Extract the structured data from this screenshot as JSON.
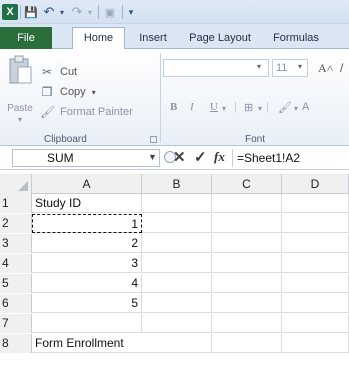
{
  "qat": {
    "logo": "X",
    "save": "💾",
    "undo": "↶",
    "redo": "↷",
    "extra": "▣"
  },
  "tabs": [
    {
      "label": "File"
    },
    {
      "label": "Home"
    },
    {
      "label": "Insert"
    },
    {
      "label": "Page Layout"
    },
    {
      "label": "Formulas"
    }
  ],
  "ribbon": {
    "paste": "Paste",
    "cut": "Cut",
    "copy": "Copy",
    "format_painter": "Format Painter",
    "clipboard_label": "Clipboard",
    "font_size": "11",
    "font_label": "Font",
    "bold": "B",
    "italic": "I",
    "underline": "U"
  },
  "formula_bar": {
    "name_box": "SUM",
    "cancel": "✕",
    "enter": "✓",
    "fx": "fx",
    "formula": "=Sheet1!A2"
  },
  "grid": {
    "columns": [
      "A",
      "B",
      "C",
      "D"
    ],
    "rows": [
      {
        "num": "1",
        "a": "Study ID"
      },
      {
        "num": "2",
        "a": "1"
      },
      {
        "num": "3",
        "a": "2"
      },
      {
        "num": "4",
        "a": "3"
      },
      {
        "num": "5",
        "a": "4"
      },
      {
        "num": "6",
        "a": "5"
      },
      {
        "num": "7",
        "a": ""
      },
      {
        "num": "8",
        "a": "Form Enrollment"
      }
    ]
  }
}
